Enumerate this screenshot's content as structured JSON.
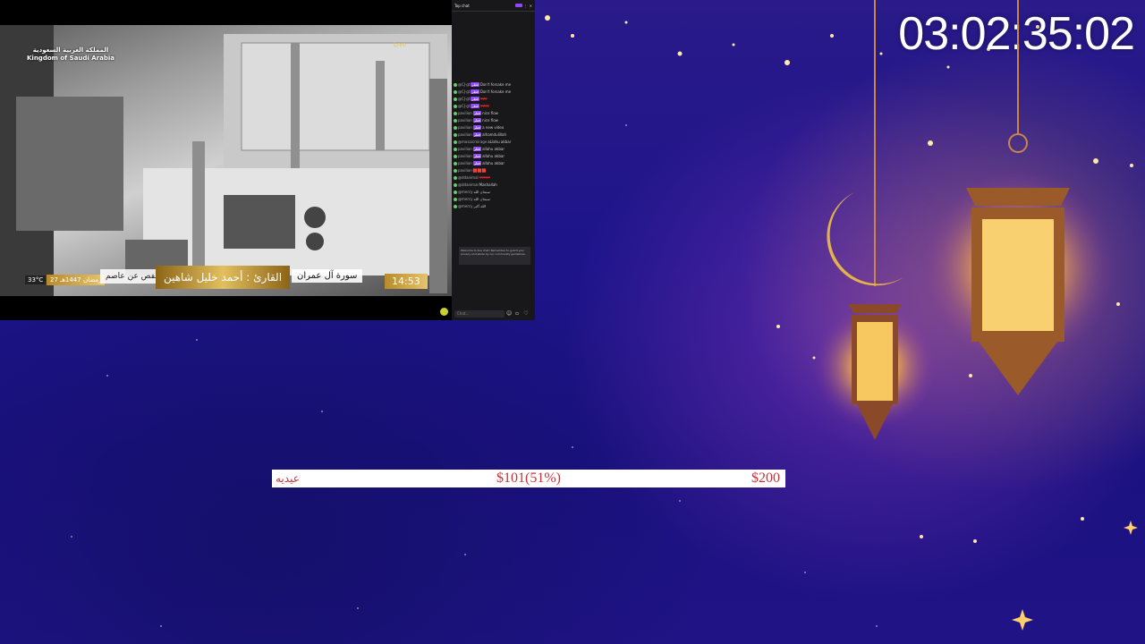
{
  "timer": {
    "value": "03:02:35:02"
  },
  "video": {
    "channel_ar": "المملكة العربية السعودية",
    "channel_en": "Kingdom of Saudi Arabia",
    "live_label": "Live",
    "temperature": "33°C",
    "hijri_date": "27 رمضان 1447هـ",
    "riwaya": "رواية حفص عن عاصم",
    "qari": "القارئ : أحمد خليل شاهين",
    "sura": "سورة آل عمران",
    "time": "14:53"
  },
  "chat": {
    "header_title": "Top chat",
    "input_placeholder": "Chat...",
    "messages": [
      {
        "user": "@CJ·gt",
        "badge": "قطر",
        "text": "Don't forsake me"
      },
      {
        "user": "@CJ·gt",
        "badge": "قطر",
        "text": "Don't forsake me"
      },
      {
        "user": "@CJ·gt",
        "badge": "قطر",
        "text": "❤❤❤"
      },
      {
        "user": "@CJ·gt",
        "badge": "قطر",
        "text": "❤❤❤❤"
      },
      {
        "user": "pavilion",
        "badge": "قطر",
        "text": "nice flow"
      },
      {
        "user": "pavilion",
        "badge": "قطر",
        "text": "nice flow"
      },
      {
        "user": "pavilion",
        "badge": "قطر",
        "text": "a new video"
      },
      {
        "user": "pavilion",
        "badge": "قطر",
        "text": "alhamdulillah"
      },
      {
        "user": "@mosaicmirage",
        "badge": "",
        "text": "aLlahu akbar"
      },
      {
        "user": "pavilion",
        "badge": "قطر",
        "text": "allahu akbar"
      },
      {
        "user": "pavilion",
        "badge": "قطر",
        "text": "allahu akbar"
      },
      {
        "user": "pavilion",
        "badge": "قطر",
        "text": "allahu akbar"
      },
      {
        "user": "pavilion",
        "badge": "",
        "text": "🟥🟥🟥"
      },
      {
        "user": "@ddanimal",
        "badge": "",
        "text": "❤❤❤❤❤"
      },
      {
        "user": "@ddanimal",
        "badge": "",
        "text": "Mashallah"
      },
      {
        "user": "@mercy",
        "badge": "",
        "text": "سبحان الله"
      },
      {
        "user": "@mercy",
        "badge": "",
        "text": "سبحان الله"
      },
      {
        "user": "@mercy",
        "badge": "",
        "text": "الله أكبر"
      }
    ],
    "notice": "Welcome to live chat! Remember to guard your privacy and abide by our community guidelines."
  },
  "goal": {
    "name": "عيديه",
    "current": "$101(51%)",
    "target": "$200",
    "progress": 0.51
  }
}
